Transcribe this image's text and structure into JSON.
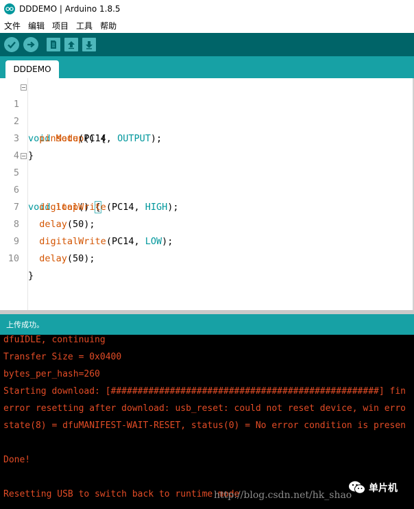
{
  "window": {
    "title": "DDDEMO | Arduino 1.8.5"
  },
  "menu": {
    "items": [
      "文件",
      "编辑",
      "项目",
      "工具",
      "帮助"
    ]
  },
  "toolbar": {
    "buttons": [
      "verify-icon",
      "upload-icon",
      "new-icon",
      "open-icon",
      "save-icon"
    ]
  },
  "tabs": [
    {
      "label": "DDDEMO"
    }
  ],
  "editor": {
    "line_numbers": [
      "1",
      "2",
      "3",
      "4",
      "5",
      "6",
      "7",
      "8",
      "9",
      "10"
    ],
    "lines": {
      "l1": {
        "kw": "void",
        "fn": "setup",
        "rest": "() {"
      },
      "l2": {
        "fn": "pinMode",
        "open": "(PC14, ",
        "cn": "OUTPUT",
        "close": ");"
      },
      "l3": {
        "text": "}"
      },
      "l5": {
        "kw": "void",
        "fn": "loop",
        "rest": "() ",
        "brace": "{"
      },
      "l6": {
        "fn": "digitalWrite",
        "open": "(PC14, ",
        "cn": "HIGH",
        "close": ");"
      },
      "l7": {
        "fn": "delay",
        "rest": "(50);"
      },
      "l8": {
        "fn": "digitalWrite",
        "open": "(PC14, ",
        "cn": "LOW",
        "close": ");"
      },
      "l9": {
        "fn": "delay",
        "rest": "(50);"
      },
      "l10": {
        "text": "}"
      }
    }
  },
  "status": {
    "message": "上传成功。"
  },
  "console": {
    "lines": [
      "dfuIDLE, continuing",
      "Transfer Size = 0x0400",
      "bytes_per_hash=260",
      "Starting download: [##################################################] fin",
      "error resetting after download: usb_reset: could not reset device, win erro",
      "state(8) = dfuMANIFEST-WAIT-RESET, status(0) = No error condition is presen",
      "",
      "Done!",
      "",
      "Resetting USB to switch back to runtime mode"
    ]
  },
  "watermark": {
    "url": "http://blog.csdn.net/hk_shao",
    "brand": "单片机"
  },
  "colors": {
    "toolbar": "#006468",
    "tabstrip": "#17a1a5",
    "keyword": "#00979c",
    "function": "#d35400",
    "console_text": "#e34c26"
  }
}
